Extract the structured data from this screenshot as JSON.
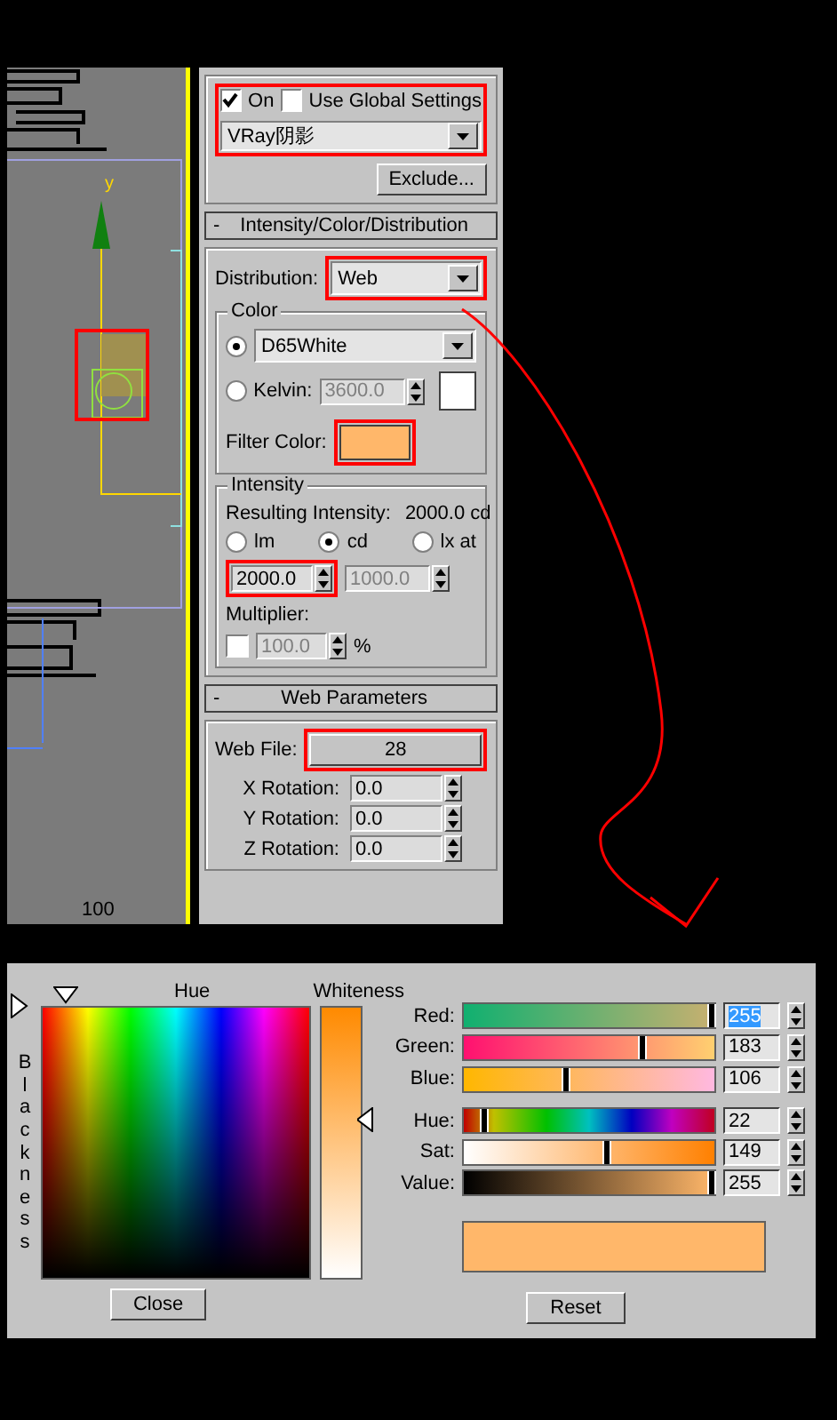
{
  "viewport": {
    "axis_label": "y",
    "ruler_label": "100",
    "light_highlighted": true
  },
  "shadows": {
    "highlighted": true,
    "on": {
      "label": "On",
      "checked": true
    },
    "use_global": {
      "label": "Use Global Settings",
      "checked": false
    },
    "type": {
      "value": "VRay阴影"
    },
    "exclude_button": "Exclude..."
  },
  "intensity_rollout": {
    "toggle": "-",
    "title": "Intensity/Color/Distribution",
    "distribution": {
      "label": "Distribution:",
      "value": "Web",
      "highlighted": true
    },
    "color_group": {
      "title": "Color",
      "options": [
        {
          "kind": "preset",
          "selected": true,
          "value": "D65White"
        },
        {
          "kind": "kelvin",
          "selected": false,
          "label": "Kelvin:",
          "value": "3600.0"
        }
      ],
      "filter": {
        "label": "Filter Color:",
        "color": "#ffb76a",
        "highlighted": true
      }
    },
    "intensity_group": {
      "title": "Intensity",
      "result_label": "Resulting Intensity:",
      "result_value": "2000.0 cd",
      "units": [
        {
          "label": "lm",
          "selected": false
        },
        {
          "label": "cd",
          "selected": true
        },
        {
          "label": "lx at",
          "selected": false
        }
      ],
      "value": {
        "text": "2000.0",
        "highlighted": true
      },
      "distance": {
        "text": "1000.0",
        "disabled": true
      },
      "multiplier_label": "Multiplier:",
      "multiplier": {
        "checked": false,
        "text": "100.0",
        "unit": "%"
      }
    }
  },
  "web_rollout": {
    "toggle": "-",
    "title": "Web Parameters",
    "web_file": {
      "label": "Web File:",
      "value": "28",
      "highlighted": true
    },
    "rotations": [
      {
        "label": "X Rotation:",
        "value": "0.0"
      },
      {
        "label": "Y Rotation:",
        "value": "0.0"
      },
      {
        "label": "Z Rotation:",
        "value": "0.0"
      }
    ]
  },
  "color_dialog": {
    "hue_label": "Hue",
    "whiteness_label": "Whiteness",
    "blackness_label": "Blackness",
    "sliders": [
      {
        "kind": "red",
        "label": "Red:",
        "value": "255",
        "level": 1,
        "text_selected": true
      },
      {
        "kind": "green",
        "label": "Green:",
        "value": "183",
        "level": 0.72,
        "text_selected": false
      },
      {
        "kind": "blue",
        "label": "Blue:",
        "value": "106",
        "level": 0.42,
        "text_selected": false
      },
      {
        "kind": "hue",
        "label": "Hue:",
        "value": "22",
        "level": 0.09,
        "text_selected": false
      },
      {
        "kind": "sat",
        "label": "Sat:",
        "value": "149",
        "level": 0.58,
        "text_selected": false
      },
      {
        "kind": "value",
        "label": "Value:",
        "value": "255",
        "level": 1,
        "text_selected": false
      }
    ],
    "preview": {
      "color": "#ffb76a"
    },
    "close_button": "Close",
    "reset_button": "Reset"
  }
}
